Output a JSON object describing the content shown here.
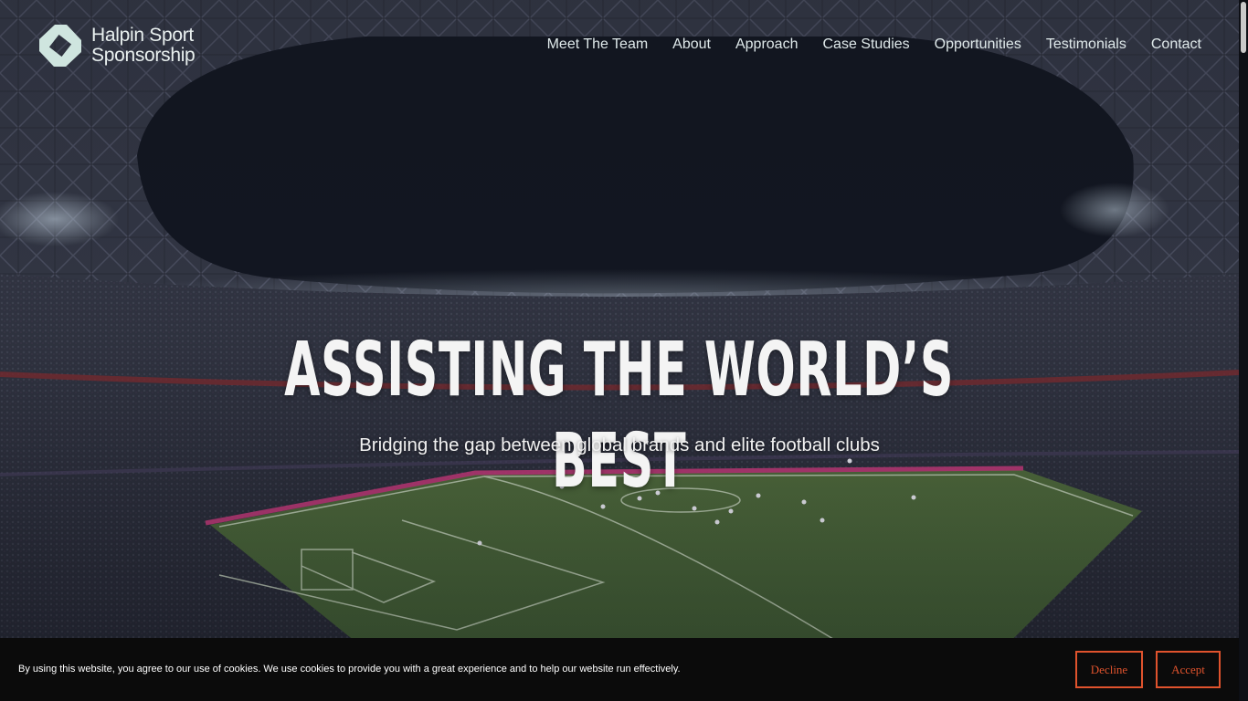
{
  "brand": {
    "name_line1": "Halpin Sport",
    "name_line2": "Sponsorship",
    "logo_icon": "halpin-logo-mark",
    "logo_color": "#cfe5df"
  },
  "nav": {
    "items": [
      {
        "label": "Meet The Team"
      },
      {
        "label": "About"
      },
      {
        "label": "Approach"
      },
      {
        "label": "Case Studies"
      },
      {
        "label": "Opportunities"
      },
      {
        "label": "Testimonials"
      },
      {
        "label": "Contact"
      }
    ]
  },
  "hero": {
    "headline": "ASSISTING THE WORLD’S BEST",
    "subheadline": "Bridging the gap between global brands and elite football clubs",
    "background": "football-stadium-photo"
  },
  "cookie": {
    "message": "By using this website, you agree to our use of cookies. We use cookies to provide you with a great experience and to help our website run effectively.",
    "decline_label": "Decline",
    "accept_label": "Accept",
    "accent_color": "#e0532d"
  }
}
